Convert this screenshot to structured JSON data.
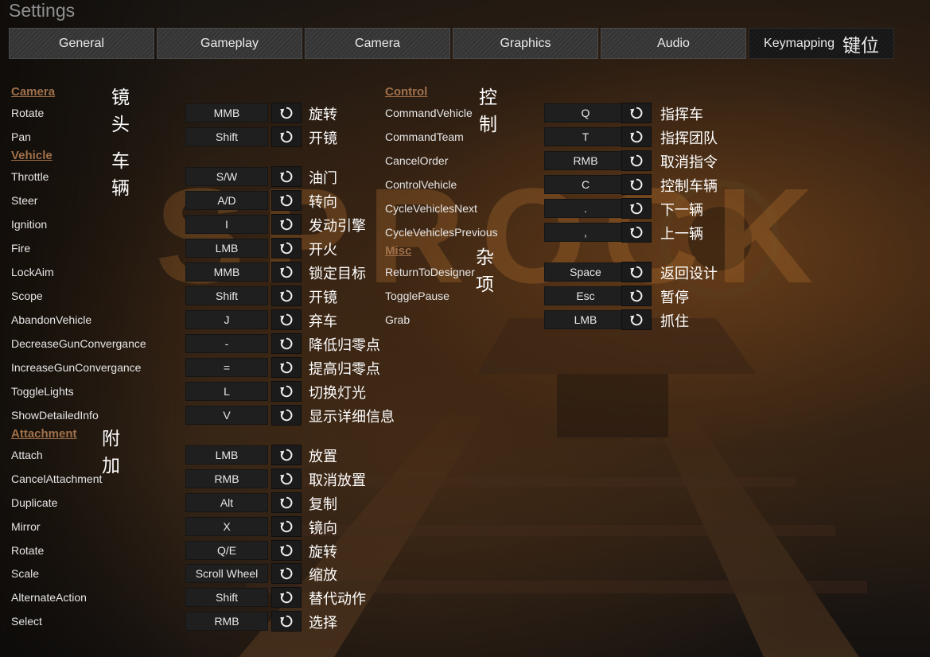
{
  "title": "Settings",
  "tabs": [
    {
      "label": "General"
    },
    {
      "label": "Gameplay"
    },
    {
      "label": "Camera"
    },
    {
      "label": "Graphics"
    },
    {
      "label": "Audio"
    },
    {
      "label": "Keymapping",
      "note": "键位"
    }
  ],
  "background_text": "SPROCK",
  "sections": {
    "camera": {
      "title": "Camera",
      "note": "镜头"
    },
    "vehicle": {
      "title": "Vehicle",
      "note": "车辆"
    },
    "attachment": {
      "title": "Attachment",
      "note": "附加"
    },
    "control": {
      "title": "Control",
      "note": "控制"
    },
    "misc": {
      "title": "Misc",
      "note": "杂项"
    }
  },
  "bindings": {
    "camera": [
      {
        "action": "Rotate",
        "key": "MMB",
        "note": "旋转"
      },
      {
        "action": "Pan",
        "key": "Shift",
        "note": "开镜"
      }
    ],
    "vehicle": [
      {
        "action": "Throttle",
        "key": "S/W",
        "note": "油门"
      },
      {
        "action": "Steer",
        "key": "A/D",
        "note": "转向"
      },
      {
        "action": "Ignition",
        "key": "I",
        "note": "发动引擎"
      },
      {
        "action": "Fire",
        "key": "LMB",
        "note": "开火"
      },
      {
        "action": "LockAim",
        "key": "MMB",
        "note": "锁定目标"
      },
      {
        "action": "Scope",
        "key": "Shift",
        "note": "开镜"
      },
      {
        "action": "AbandonVehicle",
        "key": "J",
        "note": "弃车"
      },
      {
        "action": "DecreaseGunConvergance",
        "key": "-",
        "note": "降低归零点"
      },
      {
        "action": "IncreaseGunConvergance",
        "key": "=",
        "note": "提高归零点"
      },
      {
        "action": "ToggleLights",
        "key": "L",
        "note": "切换灯光"
      },
      {
        "action": "ShowDetailedInfo",
        "key": "V",
        "note": "显示详细信息"
      }
    ],
    "attachment": [
      {
        "action": "Attach",
        "key": "LMB",
        "note": "放置"
      },
      {
        "action": "CancelAttachment",
        "key": "RMB",
        "note": "取消放置"
      },
      {
        "action": "Duplicate",
        "key": "Alt",
        "note": "复制"
      },
      {
        "action": "Mirror",
        "key": "X",
        "note": "镜向"
      },
      {
        "action": "Rotate",
        "key": "Q/E",
        "note": "旋转"
      },
      {
        "action": "Scale",
        "key": "Scroll Wheel",
        "note": "缩放"
      },
      {
        "action": "AlternateAction",
        "key": "Shift",
        "note": "替代动作"
      },
      {
        "action": "Select",
        "key": "RMB",
        "note": "选择"
      }
    ],
    "control": [
      {
        "action": "CommandVehicle",
        "key": "Q",
        "note": "指挥车"
      },
      {
        "action": "CommandTeam",
        "key": "T",
        "note": "指挥团队"
      },
      {
        "action": "CancelOrder",
        "key": "RMB",
        "note": "取消指令"
      },
      {
        "action": "ControlVehicle",
        "key": "C",
        "note": "控制车辆"
      },
      {
        "action": "CycleVehiclesNext",
        "key": ".",
        "note": "下一辆"
      },
      {
        "action": "CycleVehiclesPrevious",
        "key": ",",
        "note": "上一辆"
      }
    ],
    "misc": [
      {
        "action": "ReturnToDesigner",
        "key": "Space",
        "note": "返回设计"
      },
      {
        "action": "TogglePause",
        "key": "Esc",
        "note": "暂停"
      },
      {
        "action": "Grab",
        "key": "LMB",
        "note": "抓住"
      }
    ]
  },
  "icons": {
    "reset": "reset-icon"
  },
  "colors": {
    "section_header": "#a0704a",
    "accent_glow": "#c07a35"
  }
}
